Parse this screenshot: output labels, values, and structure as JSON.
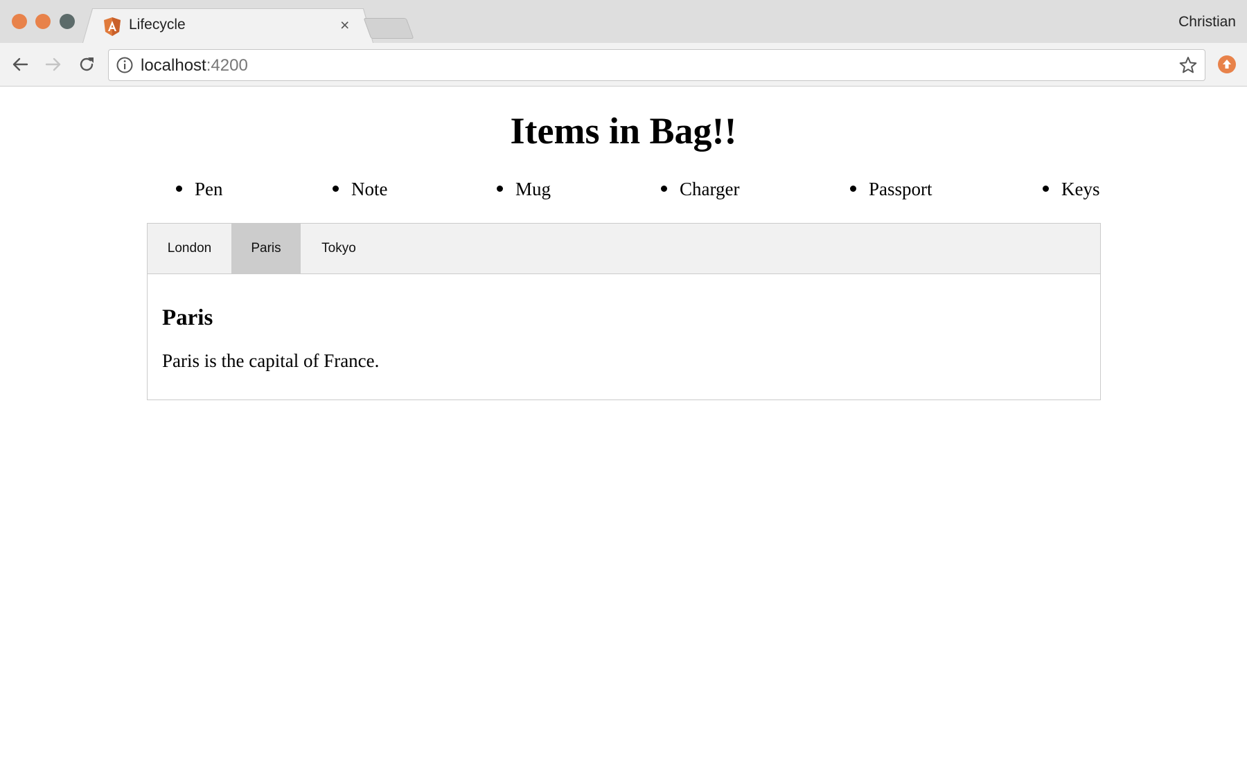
{
  "browser": {
    "tab_title": "Lifecycle",
    "tab_close": "×",
    "profile_name": "Christian",
    "url_host": "localhost",
    "url_port": ":4200",
    "colors": {
      "traffic_close": "#e8824a",
      "traffic_min": "#e8824a",
      "traffic_max": "#5c6b6a",
      "favicon": "#e07a3b"
    },
    "icons": [
      "back-arrow-icon",
      "forward-arrow-icon",
      "reload-icon",
      "info-icon",
      "star-icon",
      "extension-icon",
      "angular-favicon-icon"
    ]
  },
  "page": {
    "title": "Items in Bag!!",
    "items": [
      "Pen",
      "Note",
      "Mug",
      "Charger",
      "Passport",
      "Keys"
    ]
  },
  "tabs": {
    "items": [
      "London",
      "Paris",
      "Tokyo"
    ],
    "active": "Paris",
    "active_color": "#cccccc"
  },
  "content": {
    "heading": "Paris",
    "description": "Paris is the capital of France."
  }
}
